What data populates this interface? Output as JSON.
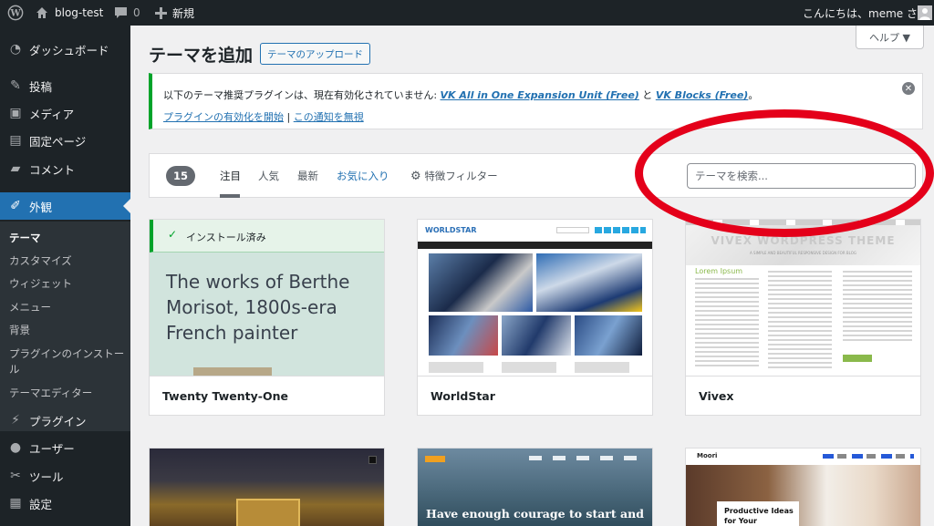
{
  "adminbar": {
    "site_name": "blog-test",
    "comments_count": "0",
    "new_label": "新規",
    "greeting": "こんにちは、meme さん"
  },
  "sidebar": {
    "items": [
      {
        "label": "ダッシュボード",
        "icon": "dashboard-icon"
      },
      {
        "label": "投稿",
        "icon": "pin-icon"
      },
      {
        "label": "メディア",
        "icon": "media-icon"
      },
      {
        "label": "固定ページ",
        "icon": "page-icon"
      },
      {
        "label": "コメント",
        "icon": "comment-icon"
      },
      {
        "label": "外観",
        "icon": "brush-icon"
      },
      {
        "label": "プラグイン",
        "icon": "plugin-icon"
      },
      {
        "label": "ユーザー",
        "icon": "user-icon"
      },
      {
        "label": "ツール",
        "icon": "wrench-icon"
      },
      {
        "label": "設定",
        "icon": "settings-icon"
      }
    ],
    "submenu": [
      "テーマ",
      "カスタマイズ",
      "ウィジェット",
      "メニュー",
      "背景",
      "プラグインのインストー",
      "ル",
      "テーマエディター"
    ]
  },
  "header": {
    "title": "テーマを追加",
    "upload_label": "テーマのアップロード",
    "help_label": "ヘルプ ▼"
  },
  "notice": {
    "text_before": "以下のテーマ推奨プラグインは、現在有効化されていません: ",
    "plugin1": "VK All in One Expansion Unit (Free)",
    "and": " と ",
    "plugin2": "VK Blocks (Free)",
    "period": "。",
    "activate_link": "プラグインの有効化を開始",
    "separator": " | ",
    "dismiss_link": "この通知を無視"
  },
  "filter": {
    "count": "15",
    "tabs": [
      "注目",
      "人気",
      "最新",
      "お気に入り"
    ],
    "feature_filter": "特徴フィルター",
    "search_placeholder": "テーマを検索..."
  },
  "themes": [
    {
      "name": "Twenty Twenty-One",
      "installed_label": "インストール済み",
      "preview_text": "The works of Berthe Morisot, 1800s-era French painter"
    },
    {
      "name": "WorldStar",
      "logo": "WORLDSTAR"
    },
    {
      "name": "Vivex",
      "banner": "VIVEX WORDPRESS THEME",
      "sub_banner": "A SIMPLE AND BEAUTIFUL RESPONSIVE DESIGN FOR BLOG",
      "lorem": "Lorem Ipsum"
    }
  ],
  "second_row": {
    "card2_headline": "Have enough courage to start and",
    "card3_logo": "Moori",
    "card3_headline": "Productive Ideas for Your"
  },
  "colors": {
    "adminbar": "#1d2327",
    "accent": "#2271b1",
    "notice_border": "#00a32a",
    "annotation": "#e4001a"
  }
}
